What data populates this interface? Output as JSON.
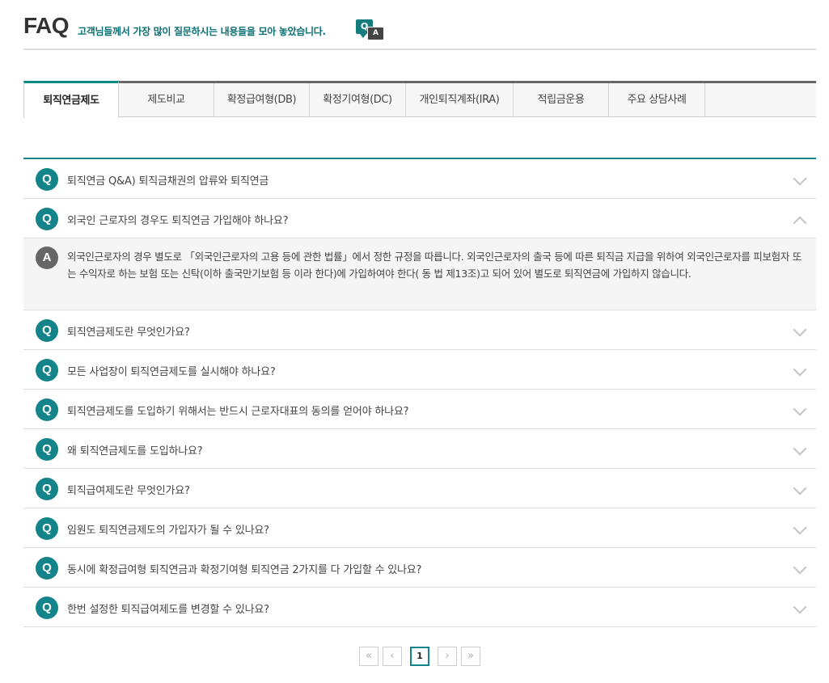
{
  "header": {
    "title": "FAQ",
    "subtitle": "고객님들께서 가장 많이 질문하시는 내용들을 모아 놓았습니다.",
    "qa_icon_q": "Q",
    "qa_icon_a": "A"
  },
  "tabs": [
    {
      "label": "퇴직연금제도",
      "active": true
    },
    {
      "label": "제도비교"
    },
    {
      "label": "확정급여형(DB)"
    },
    {
      "label": "확정기여형(DC)"
    },
    {
      "label": "개인퇴직계좌(IRA)"
    },
    {
      "label": "적립금운용"
    },
    {
      "label": "주요 상담사례"
    }
  ],
  "faq": {
    "q_badge": "Q",
    "a_badge": "A",
    "items": [
      {
        "question": "퇴직연금 Q&A) 퇴직금채권의 압류와 퇴직연금"
      },
      {
        "question": "외국인 근로자의 경우도 퇴직연금 가입해야 하나요?",
        "open": true,
        "answer": "외국인근로자의 경우 별도로 「외국인근로자의 고용 등에 관한 법률」에서 정한 규정을 따릅니다. 외국인근로자의 출국 등에 따른 퇴직금 지급을 위하여 외국인근로자를 피보험자 또는 수익자로 하는 보험 또는 신탁(이하 출국만기보험 등 이라 한다)에 가입하여야 한다( 동 법 제13조)고 되어 있어 별도로 퇴직연금에 가입하지 않습니다."
      },
      {
        "question": "퇴직연금제도란 무엇인가요?"
      },
      {
        "question": "모든 사업장이 퇴직연금제도를 실시해야 하나요?"
      },
      {
        "question": "퇴직연금제도를 도입하기 위해서는 반드시 근로자대표의 동의를 얻어야 하나요?"
      },
      {
        "question": "왜 퇴직연금제도를 도입하나요?"
      },
      {
        "question": "퇴직급여제도란 무엇인가요?"
      },
      {
        "question": "임원도 퇴직연금제도의 가입자가 될 수 있나요?"
      },
      {
        "question": "동시에 확정급여형 퇴직연금과 확정기여형 퇴직연금 2가지를 다 가입할 수 있나요?"
      },
      {
        "question": "한번 설정한 퇴직급여제도를 변경할 수 있나요?"
      }
    ]
  },
  "pagination": {
    "first": "«",
    "prev": "‹",
    "current": "1",
    "next": "›",
    "last": "»"
  }
}
